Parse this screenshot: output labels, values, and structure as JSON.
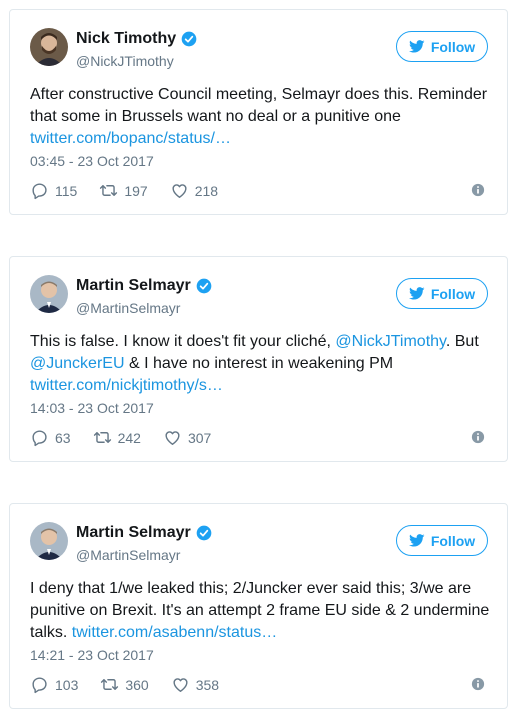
{
  "tweets": [
    {
      "name": "Nick Timothy",
      "handle": "@NickJTimothy",
      "follow_label": "Follow",
      "text_parts": [
        {
          "t": "After constructive Council meeting, Selmayr does this. Reminder that some in Brussels want no deal or a punitive one ",
          "link": false
        },
        {
          "t": "twitter.com/bopanc/status/…",
          "link": true
        }
      ],
      "timestamp": "03:45 - 23 Oct 2017",
      "replies": "115",
      "retweets": "197",
      "likes": "218",
      "avatar_icon": "avatar-photo"
    },
    {
      "name": "Martin Selmayr",
      "handle": "@MartinSelmayr",
      "follow_label": "Follow",
      "text_parts": [
        {
          "t": "This is false. I know it does't fit your cliché, ",
          "link": false
        },
        {
          "t": "@NickJTimothy",
          "link": true
        },
        {
          "t": ". But ",
          "link": false
        },
        {
          "t": "@JunckerEU",
          "link": true
        },
        {
          "t": " & I have no interest in weakening PM ",
          "link": false
        },
        {
          "t": "twitter.com/nickjtimothy/s…",
          "link": true
        }
      ],
      "timestamp": "14:03 - 23 Oct 2017",
      "replies": "63",
      "retweets": "242",
      "likes": "307",
      "avatar_icon": "avatar-photo"
    },
    {
      "name": "Martin Selmayr",
      "handle": "@MartinSelmayr",
      "follow_label": "Follow",
      "text_parts": [
        {
          "t": "I deny that 1/we leaked this; 2/Juncker ever said this; 3/we are punitive on Brexit. It's an attempt 2 frame EU side & 2 undermine talks. ",
          "link": false
        },
        {
          "t": "twitter.com/asabenn/status…",
          "link": true
        }
      ],
      "timestamp": "14:21 - 23 Oct 2017",
      "replies": "103",
      "retweets": "360",
      "likes": "358",
      "avatar_icon": "avatar-photo"
    }
  ],
  "colors": {
    "accent": "#1da1f2",
    "link": "#1b95e0",
    "muted": "#657786",
    "border": "#e1e8ed"
  },
  "icons": {
    "verified": "verified-badge-icon",
    "reply": "reply-icon",
    "retweet": "retweet-icon",
    "like": "heart-icon",
    "info": "info-icon",
    "follow": "twitter-bird-icon"
  }
}
